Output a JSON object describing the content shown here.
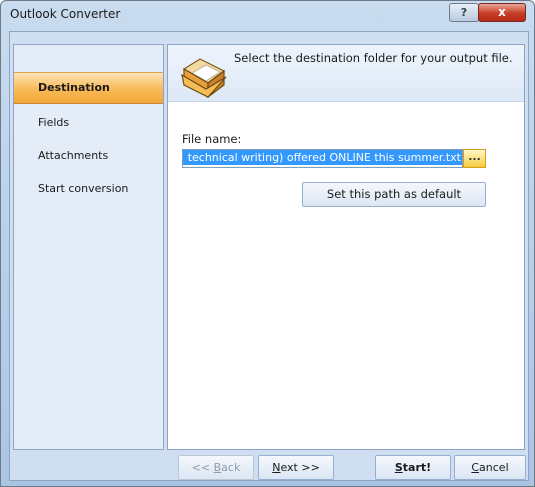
{
  "window": {
    "title": "Outlook Converter",
    "help_label": "?",
    "close_label": "x"
  },
  "sidebar": {
    "items": [
      {
        "label": "Destination",
        "active": true
      },
      {
        "label": "Fields",
        "active": false
      },
      {
        "label": "Attachments",
        "active": false
      },
      {
        "label": "Start conversion",
        "active": false
      }
    ]
  },
  "header": {
    "icon": "open-folder-icon",
    "text": "Select the destination folder for your output file."
  },
  "form": {
    "file_label": "File name:",
    "file_value": "technical writing) offered ONLINE this summer.txt",
    "browse_label": "...",
    "set_default_label": "Set this path as default"
  },
  "footer": {
    "back": {
      "pre": "<< ",
      "accel": "B",
      "post": "ack"
    },
    "next": {
      "accel": "N",
      "post": "ext >>"
    },
    "start": {
      "accel": "S",
      "post": "tart!"
    },
    "cancel": {
      "accel": "C",
      "post": "ancel"
    }
  },
  "colors": {
    "accent_orange": "#f8b955",
    "selection": "#3399ff",
    "close_red": "#c63d26"
  }
}
